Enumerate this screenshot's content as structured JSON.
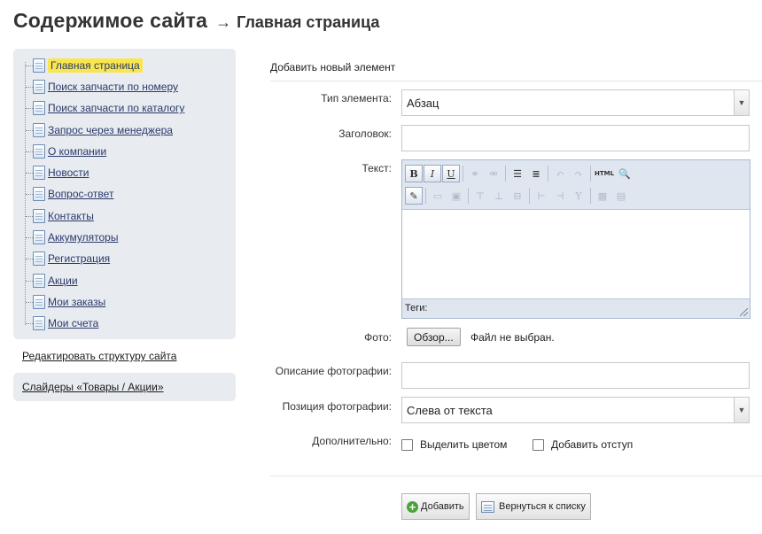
{
  "header": {
    "title": "Содержимое сайта",
    "arrow": "→",
    "subtitle": "Главная страница"
  },
  "sidebar": {
    "items": [
      {
        "label": "Главная страница",
        "active": true
      },
      {
        "label": "Поиск запчасти по номеру"
      },
      {
        "label": "Поиск запчасти по каталогу"
      },
      {
        "label": "Запрос через менеджера"
      },
      {
        "label": "О компании"
      },
      {
        "label": "Новости"
      },
      {
        "label": "Вопрос-ответ"
      },
      {
        "label": "Контакты"
      },
      {
        "label": "Аккумуляторы"
      },
      {
        "label": "Регистрация"
      },
      {
        "label": "Акции"
      },
      {
        "label": "Мои заказы"
      },
      {
        "label": "Мои счета"
      }
    ],
    "edit_link": "Редактировать структуру сайта",
    "sliders_link": "Слайдеры «Товары / Акции»"
  },
  "form": {
    "title": "Добавить новый элемент",
    "type_label": "Тип элемента:",
    "type_value": "Абзац",
    "heading_label": "Заголовок:",
    "heading_value": "",
    "text_label": "Текст:",
    "editor_status": "Теги:",
    "photo_label": "Фото:",
    "photo_button": "Обзор...",
    "photo_status": "Файл не выбран.",
    "photo_desc_label": "Описание фотографии:",
    "photo_desc_value": "",
    "photo_pos_label": "Позиция фотографии:",
    "photo_pos_value": "Слева от текста",
    "extra_label": "Дополнительно:",
    "highlight_label": "Выделить цветом",
    "indent_label": "Добавить отступ",
    "add_button": "Добавить",
    "back_button": "Вернуться к списку"
  },
  "toolbar": {
    "bold": "B",
    "italic": "I",
    "underline": "U",
    "html": "HTML"
  }
}
